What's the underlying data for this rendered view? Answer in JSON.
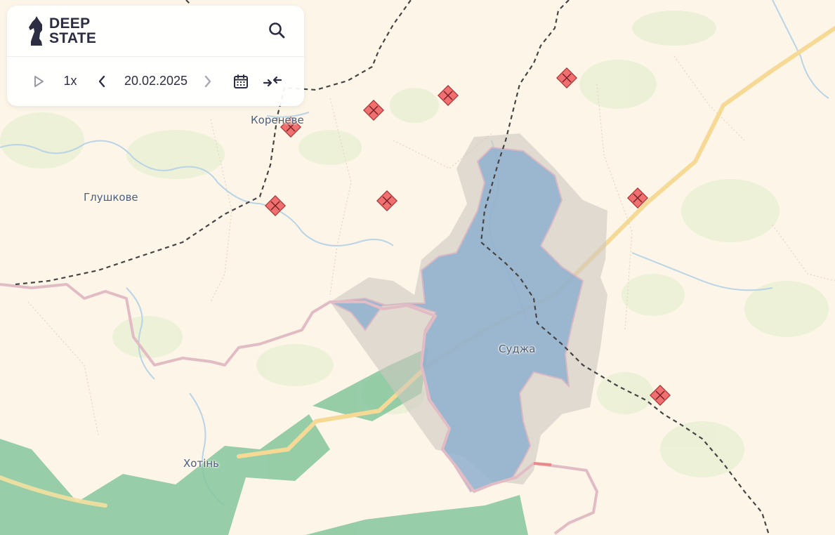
{
  "app": {
    "logo_line1": "DEEP",
    "logo_line2": "STATE"
  },
  "toolbar": {
    "speed": "1x",
    "date": "20.02.2025",
    "icons": {
      "play": "play-icon",
      "prev": "chevron-left-icon",
      "next": "chevron-right-icon",
      "calendar": "calendar-icon",
      "collapse": "collapse-arrows-icon",
      "search": "search-icon"
    }
  },
  "map": {
    "places": [
      "Кореневе",
      "Глушкове",
      "Суджа",
      "Хотінь"
    ],
    "legend_colors": {
      "occupied_blue": "#8fb0cf",
      "grey_zone": "#cfc8c0",
      "liberated_green": "#7cc396",
      "border_pink": "#e2bcc4",
      "marker_red": "#f07072",
      "road_yellow": "#f6dc9c",
      "front_line": "#444444"
    }
  }
}
